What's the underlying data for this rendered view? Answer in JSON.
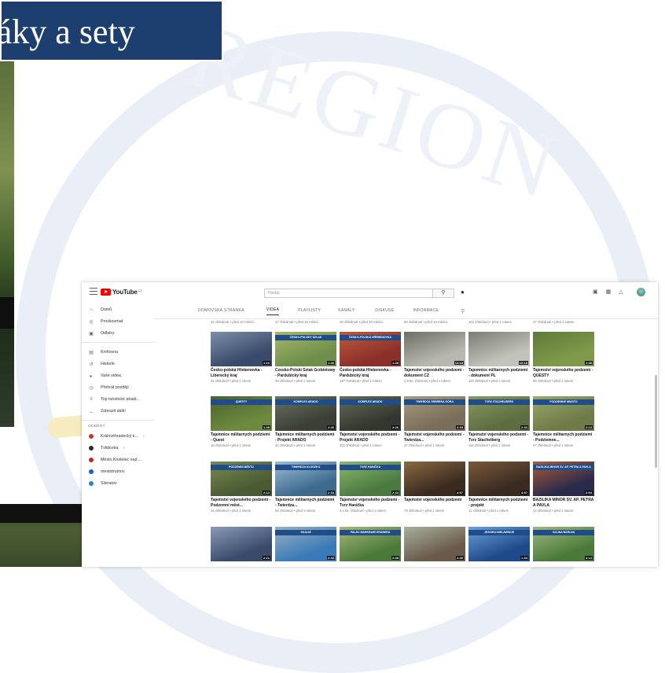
{
  "slide": {
    "title_text": "etáky a sety",
    "watermark_text": "REGION"
  },
  "colors": {
    "banner_bg": "#1d3f70",
    "youtube_red": "#ff0000",
    "watermark_ring": "#e9eef7"
  },
  "video_player": {
    "icons": [
      "clock-icon",
      "share-icon"
    ]
  },
  "youtube": {
    "logo": "YouTube",
    "logo_region": "CZ",
    "search_placeholder": "Hledat",
    "sidebar": {
      "main": [
        {
          "label": "Domů",
          "icon": "home-icon"
        },
        {
          "label": "Prozkoumat",
          "icon": "compass-icon"
        },
        {
          "label": "Odběry",
          "icon": "subscriptions-icon"
        }
      ],
      "library": [
        {
          "label": "Knihovna",
          "icon": "library-icon"
        },
        {
          "label": "Historie",
          "icon": "history-icon"
        },
        {
          "label": "Vaše videa",
          "icon": "play-square-icon"
        },
        {
          "label": "Přehrát později",
          "icon": "clock-icon"
        },
        {
          "label": "Top turistické atrakt...",
          "icon": "playlist-icon"
        },
        {
          "label": "Zobrazit další",
          "icon": "chevron-down-icon"
        }
      ],
      "subscriptions_heading": "ODBĚRY",
      "subscriptions": [
        {
          "label": "Královéhradecký k...",
          "color": "#c0392b"
        },
        {
          "label": "Tvlidozka",
          "color": "#2c2c2c"
        },
        {
          "label": "Město Kostelec nad ...",
          "color": "#c62828"
        },
        {
          "label": "mestotrutnov",
          "color": "#1565c0"
        },
        {
          "label": "Slieratov",
          "color": "#2a84c6"
        }
      ]
    },
    "tabs": [
      "DOMOVSKÁ STRÁNKA",
      "VIDEA",
      "PLAYLISTY",
      "KANÁLY",
      "DISKUSE",
      "INFORMACE"
    ],
    "active_tab": "VIDEA",
    "top_row_stats": [
      "32 zhlédnutí • před 10 měsíci",
      "47 zhlédnutí • před 10 měsíci",
      "29 zhlédnutí • před 10 měsíci",
      "50 zhlédnutí • před 10 měsíci",
      "101 zhlédnutí • před 1 rokem",
      "47 zhlédnutí • před 1 rokem"
    ],
    "videos": [
      {
        "title": "Česko-polská Hřebenovka - Liberecký kraj",
        "meta": "41 zhlédnutí • před 1 rokem",
        "duration": "1:16",
        "band": "",
        "c1": "#3a4a6a",
        "c2": "#7a8fa8"
      },
      {
        "title": "Czesko-Polski Szlak Grzbietowy - Pardubický kraj",
        "meta": "38 zhlédnutí • před 1 rokem",
        "duration": "1:36",
        "band": "ČESKO-POLSKÝ SZLAK",
        "c1": "#6e8f4a",
        "c2": "#a8b86a"
      },
      {
        "title": "Česko-polská Hřebenovka - Pardubický kraj",
        "meta": "167 zhlédnutí • před 1 rokem",
        "duration": "1:28",
        "band": "ČESKO-POLSKÁ HŘEBENOVKA",
        "c1": "#8a2f2a",
        "c2": "#c05a3a"
      },
      {
        "title": "Tajemství vojenského podzemí - dokument CZ",
        "meta": "1,8 tis. zhlédnutí • před 1 rokem",
        "duration": "13:18",
        "band": "",
        "c1": "#b8b8b0",
        "c2": "#6c6f66"
      },
      {
        "title": "Tajemnice militarnych podziemi - dokument PL",
        "meta": "119 zhlédnutí • před 1 rokem",
        "duration": "13:18",
        "band": "",
        "c1": "#c2c4bc",
        "c2": "#7a7d74"
      },
      {
        "title": "Tajemství vojenského podzemí - QUESTY",
        "meta": "96 zhlédnutí • před 1 rokem",
        "duration": "1:38",
        "band": "",
        "c1": "#7f9a4a",
        "c2": "#5e7a3a"
      },
      {
        "title": "Tajemnice militarnych podziemi - Quest",
        "meta": "16 zhlédnutí • před 1 rokem",
        "duration": "1:38",
        "band": "QUESTY",
        "c1": "#6d8a3e",
        "c2": "#4a5f30"
      },
      {
        "title": "Tajemnice militarnych podziemi - Projekt ARADO",
        "meta": "32 zhlédnutí • před 1 rokem",
        "duration": "2:26",
        "band": "KOMPLEX ARADO",
        "c1": "#3b3f36",
        "c2": "#6a7260"
      },
      {
        "title": "Tajemství vojenského podzemí - Projekt ARADO",
        "meta": "202 zhlédnutí • před 1 rokem",
        "duration": "2:26",
        "band": "KOMPLEX ARADO",
        "c1": "#33372f",
        "c2": "#646c5a"
      },
      {
        "title": "Tajemství vojenského podzemí - Twierdza...",
        "meta": "27 zhlédnutí • před 1 rokem",
        "duration": "2:33",
        "band": "TWIERDZA SREBRNA GÓRA",
        "c1": "#7a6e5a",
        "c2": "#a89a80"
      },
      {
        "title": "Tajemství vojenského podzemí - Tvrz Stachelberg",
        "meta": "116 zhlédnutí • před 1 rokem",
        "duration": "2:33",
        "band": "TVRZ STACHELBERG",
        "c1": "#5c6e40",
        "c2": "#8a9860"
      },
      {
        "title": "Tajemnice militarnych podziemi - Podziemne...",
        "meta": "47 zhlédnutí • před 1 rokem",
        "duration": "2:13",
        "band": "PODZIEMNE MIASTO",
        "c1": "#6e7a48",
        "c2": "#9aa86a"
      },
      {
        "title": "Tajemství vojenského podzemí - Podzemní měst...",
        "meta": "15 zhlédnutí • před 1 rokem",
        "duration": "2:13",
        "band": "PODZEMNÍ MĚSTO",
        "c1": "#4a5a34",
        "c2": "#7a8a50"
      },
      {
        "title": "Tajemnice militarnych podziemi - Twierdza...",
        "meta": "54 zhlédnutí • před 1 rokem",
        "duration": "2:34",
        "band": "TWIERDZA KŁODZKO",
        "c1": "#3e6a8e",
        "c2": "#9abbd6"
      },
      {
        "title": "Tajemství vojenského podzemí - Tvrz Hanička",
        "meta": "2,1 tis. zhlédnutí • před 1 rokem",
        "duration": "2:33",
        "band": "TVRZ HANIČKA",
        "c1": "#4a7a40",
        "c2": "#8ab870"
      },
      {
        "title": "Tajemství vojenského podzemí",
        "meta": "79 zhlédnutí • před 1 rokem",
        "duration": "4:57",
        "band": "",
        "c1": "#3a2a20",
        "c2": "#8a6a40"
      },
      {
        "title": "Tajemnice militarnych podziemi - projekt",
        "meta": "11 zhlédnutí • před 1 rokem",
        "duration": "4:57",
        "band": "",
        "c1": "#3a2a22",
        "c2": "#7a5a3a"
      },
      {
        "title": "BAZILIKA MINOR SV. AP. PETRA A PAVLA",
        "meta": "12 zhlédnutí • před 1 rokem",
        "duration": "2:54",
        "band": "BAZILIKA MINOR SV. AP. PETRA A PAVLA",
        "c1": "#2a2a4a",
        "c2": "#a85a3a"
      },
      {
        "title": "",
        "meta": "",
        "duration": "2:21",
        "band": "",
        "c1": "#3a4a6a",
        "c2": "#8a9ab8"
      },
      {
        "title": "",
        "meta": "",
        "duration": "2:33",
        "band": "SKALNÍ",
        "c1": "#3a7ab8",
        "c2": "#9ab0c0"
      },
      {
        "title": "",
        "meta": "",
        "duration": "2:38",
        "band": "PALÁC MARKRABÍ GRABERÁ",
        "c1": "#4a7a3a",
        "c2": "#a8b87a"
      },
      {
        "title": "",
        "meta": "",
        "duration": "2:36",
        "band": "",
        "c1": "#6a5a4a",
        "c2": "#a8b0a0"
      },
      {
        "title": "",
        "meta": "",
        "duration": "1:34",
        "band": "JEZIORO BIELAWSKIE",
        "c1": "#1e4a8a",
        "c2": "#6aa0d8"
      },
      {
        "title": "",
        "meta": "",
        "duration": "3:14",
        "band": "SZLINA BARLINI",
        "c1": "#4a7a3a",
        "c2": "#a0b880"
      }
    ]
  }
}
